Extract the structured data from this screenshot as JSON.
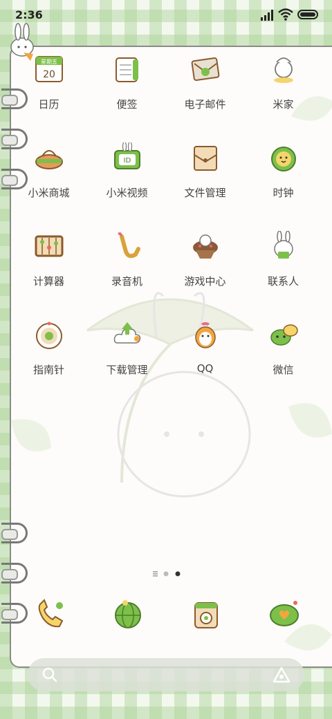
{
  "status_bar": {
    "time": "2:36"
  },
  "apps": [
    {
      "id": "calendar",
      "label": "日历",
      "icon": "calendar-icon",
      "calendar_weekday": "星期五",
      "calendar_day": "20"
    },
    {
      "id": "notes",
      "label": "便签",
      "icon": "notes-icon"
    },
    {
      "id": "email",
      "label": "电子邮件",
      "icon": "email-icon"
    },
    {
      "id": "mihome",
      "label": "米家",
      "icon": "mihome-icon"
    },
    {
      "id": "mall",
      "label": "小米商城",
      "icon": "shopping-basket-icon"
    },
    {
      "id": "video",
      "label": "小米视频",
      "icon": "video-icon"
    },
    {
      "id": "files",
      "label": "文件管理",
      "icon": "folder-icon"
    },
    {
      "id": "clock",
      "label": "时钟",
      "icon": "clock-icon"
    },
    {
      "id": "calc",
      "label": "计算器",
      "icon": "abacus-icon"
    },
    {
      "id": "recorder",
      "label": "录音机",
      "icon": "saxophone-icon"
    },
    {
      "id": "games",
      "label": "游戏中心",
      "icon": "cupcake-icon"
    },
    {
      "id": "contacts",
      "label": "联系人",
      "icon": "contacts-bunny-icon"
    },
    {
      "id": "compass",
      "label": "指南针",
      "icon": "compass-icon"
    },
    {
      "id": "downloads",
      "label": "下载管理",
      "icon": "download-cloud-icon"
    },
    {
      "id": "qq",
      "label": "QQ",
      "icon": "qq-penguin-icon"
    },
    {
      "id": "wechat",
      "label": "微信",
      "icon": "wechat-bubbles-icon"
    }
  ],
  "page_indicator": {
    "pages": 3,
    "current": 3
  },
  "dock": [
    {
      "id": "phone",
      "icon": "phone-icon"
    },
    {
      "id": "browser",
      "icon": "globe-icon"
    },
    {
      "id": "camera",
      "icon": "camera-icon"
    },
    {
      "id": "messages",
      "icon": "message-heart-icon"
    }
  ],
  "search_bar": {
    "left_icon": "search-icon",
    "right_icon": "assistant-icon"
  },
  "colors": {
    "accent_green": "#7cc04a",
    "brown": "#8b5a2b",
    "cream": "#fdfcfa",
    "check": "#cfe5bf"
  }
}
